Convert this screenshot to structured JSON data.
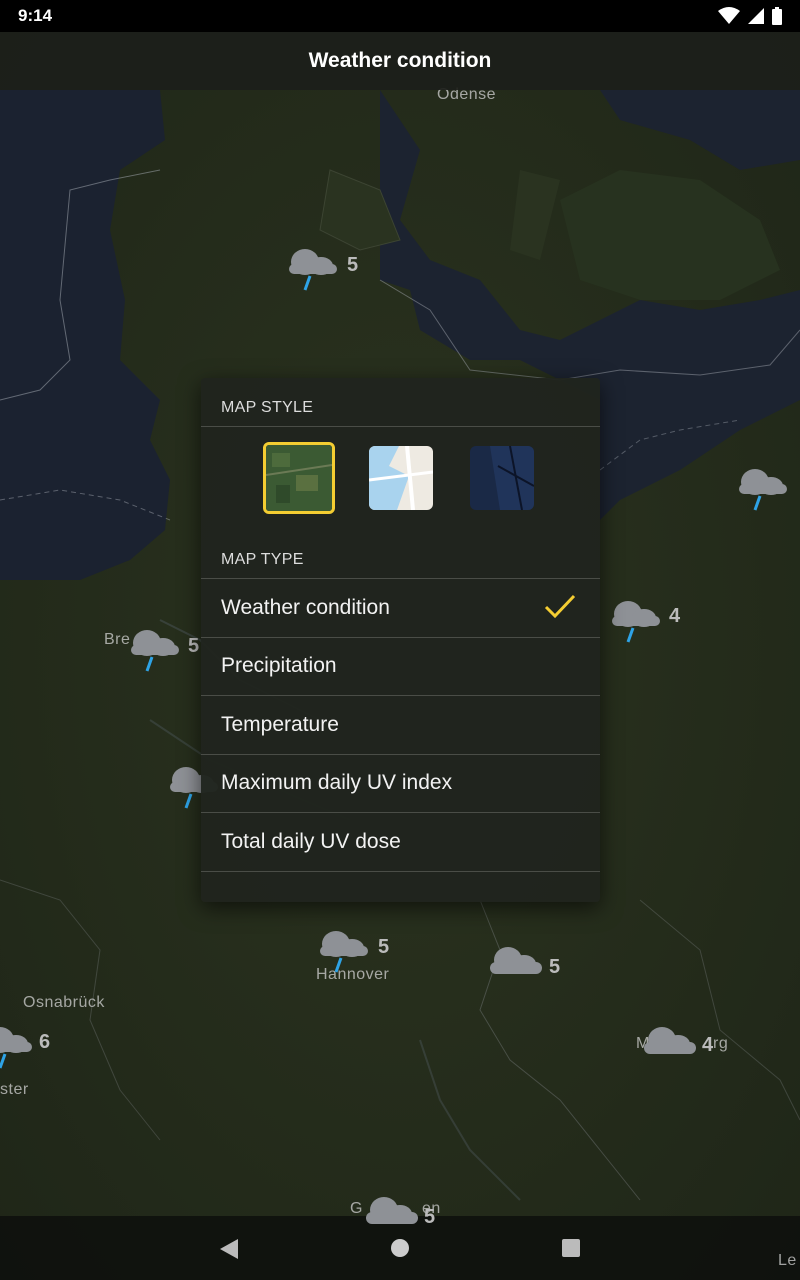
{
  "status_bar": {
    "time": "9:14",
    "icons": [
      "wifi-icon",
      "signal-icon",
      "battery-icon"
    ]
  },
  "app_bar": {
    "title": "Weather condition"
  },
  "map": {
    "cities": [
      "Odense",
      "Bremerhaven",
      "Hannover",
      "Osnabrück",
      "Münster",
      "Magdeburg",
      "Göttingen",
      "Leipzig"
    ],
    "city_labels_visible": [
      "Odense",
      "Bre",
      "Hannover",
      "Osnabrück",
      "ster",
      "M",
      "rg",
      "G",
      "en",
      "Le"
    ],
    "forecast_markers": [
      {
        "icon": "rain-cloud-icon",
        "value": "5"
      },
      {
        "icon": "rain-cloud-icon",
        "value": ""
      },
      {
        "icon": "rain-cloud-icon",
        "value": "4"
      },
      {
        "icon": "rain-cloud-icon",
        "value": "5"
      },
      {
        "icon": "rain-cloud-icon",
        "value": ""
      },
      {
        "icon": "rain-cloud-icon",
        "value": "5"
      },
      {
        "icon": "cloud-icon",
        "value": "5"
      },
      {
        "icon": "rain-cloud-icon",
        "value": "6"
      },
      {
        "icon": "cloud-icon",
        "value": "4"
      },
      {
        "icon": "cloud-icon",
        "value": "5"
      }
    ]
  },
  "popup": {
    "map_style_header": "MAP STYLE",
    "map_styles": [
      {
        "name": "satellite-style",
        "selected": true
      },
      {
        "name": "light-style",
        "selected": false
      },
      {
        "name": "dark-style",
        "selected": false
      }
    ],
    "map_type_header": "MAP TYPE",
    "map_types": [
      {
        "label": "Weather condition",
        "selected": true
      },
      {
        "label": "Precipitation",
        "selected": false
      },
      {
        "label": "Temperature",
        "selected": false
      },
      {
        "label": "Maximum daily UV index",
        "selected": false
      },
      {
        "label": "Total daily UV dose",
        "selected": false
      }
    ],
    "accent_color": "#f4cd32"
  },
  "nav_bar": {
    "buttons": [
      "back-icon",
      "home-icon",
      "recents-icon"
    ]
  }
}
